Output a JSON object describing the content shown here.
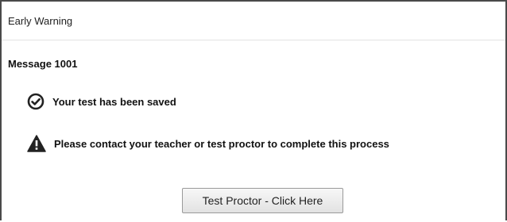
{
  "dialog": {
    "title": "Early Warning",
    "message_heading": "Message 1001",
    "saved_text": "Your test has been saved",
    "warning_text": "Please contact your teacher or test proctor to complete this process",
    "button_label": "Test Proctor - Click Here"
  },
  "icons": {
    "saved": "check-circle-icon",
    "warning": "warning-triangle-icon"
  },
  "colors": {
    "border": "#4a4a4a",
    "icon": "#222222",
    "header_divider": "#e3e3e3"
  }
}
